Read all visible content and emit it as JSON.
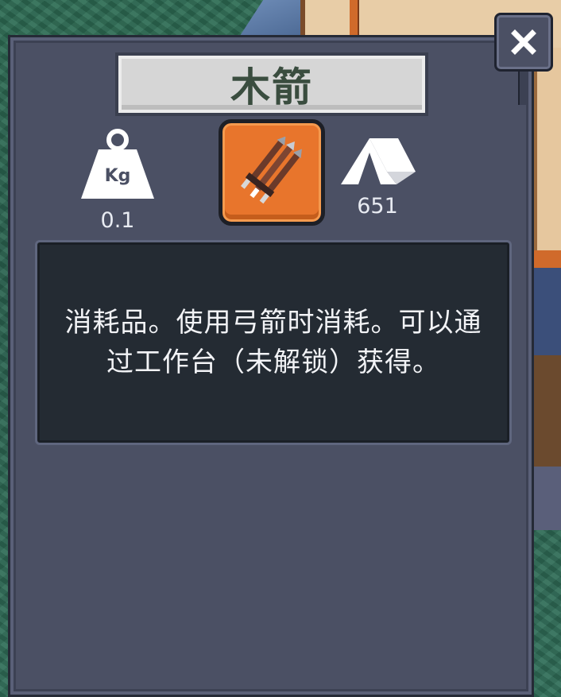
{
  "dialog": {
    "title": "木箭",
    "close_icon": "close-icon"
  },
  "item": {
    "icon": "arrow-bundle-icon",
    "slot_color": "#e8752c"
  },
  "stats": {
    "weight": {
      "icon": "weight-kg-icon",
      "icon_label": "Kg",
      "value": "0.1"
    },
    "camp": {
      "icon": "tent-icon",
      "value": "651"
    }
  },
  "description": {
    "text": "消耗品。使用弓箭时消耗。可以通过工作台（未解锁）获得。"
  },
  "colors": {
    "panel": "#4b5064",
    "description_bg": "#242b33",
    "title_bg": "#d6d6d6",
    "title_text": "#3a4d3f",
    "accent": "#e8752c"
  }
}
